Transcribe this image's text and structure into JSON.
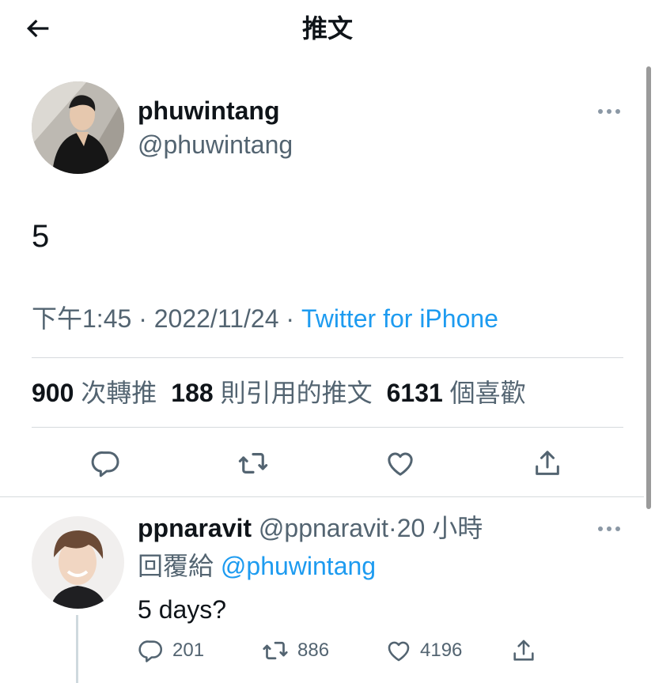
{
  "header": {
    "title": "推文",
    "back_icon": "arrow-left-icon"
  },
  "tweet": {
    "display_name": "phuwintang",
    "handle": "@phuwintang",
    "text": "5",
    "time": "下午1:45",
    "date": "2022/11/24",
    "source": "Twitter for iPhone",
    "separator": " · ",
    "stats": {
      "retweets": "900",
      "retweets_label": "次轉推",
      "quotes": "188",
      "quotes_label": "則引用的推文",
      "likes": "6131",
      "likes_label": "個喜歡"
    },
    "actions": [
      "reply-icon",
      "retweet-icon",
      "like-icon",
      "share-icon"
    ]
  },
  "reply": {
    "display_name": "ppnaravit",
    "handle": "@ppnaravit",
    "dot": "·",
    "time_ago": "20 小時",
    "replying_label": "回覆給",
    "replying_to": "@phuwintang",
    "text": "5 days?",
    "counts": {
      "replies": "201",
      "retweets": "886",
      "likes": "4196"
    }
  },
  "colors": {
    "accent": "#1d9bf0",
    "text": "#0f1419",
    "secondary": "#536471",
    "divider": "#d6dadd"
  }
}
